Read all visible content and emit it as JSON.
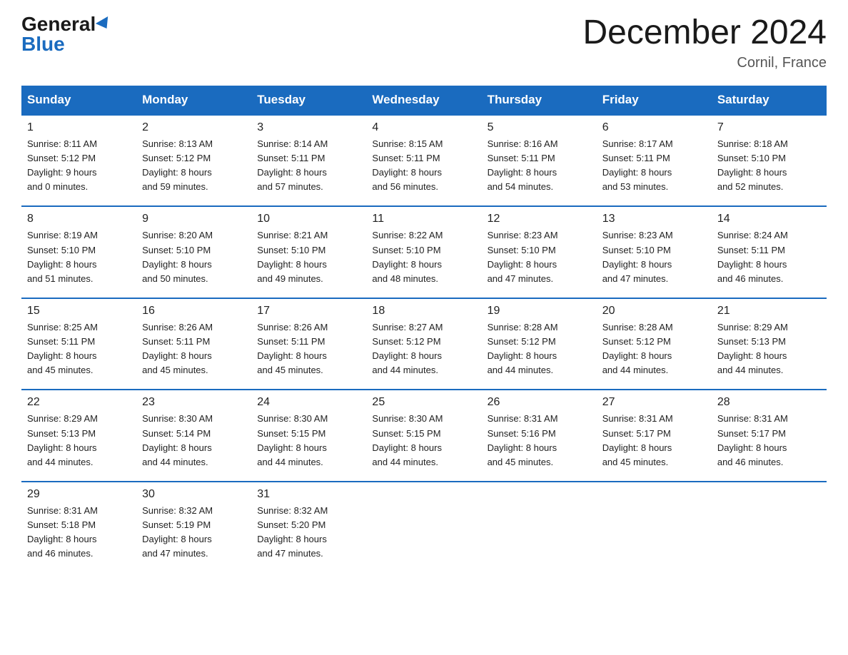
{
  "header": {
    "logo_general": "General",
    "logo_blue": "Blue",
    "month_title": "December 2024",
    "location": "Cornil, France"
  },
  "weekdays": [
    "Sunday",
    "Monday",
    "Tuesday",
    "Wednesday",
    "Thursday",
    "Friday",
    "Saturday"
  ],
  "weeks": [
    [
      {
        "day": "1",
        "detail": "Sunrise: 8:11 AM\nSunset: 5:12 PM\nDaylight: 9 hours\nand 0 minutes."
      },
      {
        "day": "2",
        "detail": "Sunrise: 8:13 AM\nSunset: 5:12 PM\nDaylight: 8 hours\nand 59 minutes."
      },
      {
        "day": "3",
        "detail": "Sunrise: 8:14 AM\nSunset: 5:11 PM\nDaylight: 8 hours\nand 57 minutes."
      },
      {
        "day": "4",
        "detail": "Sunrise: 8:15 AM\nSunset: 5:11 PM\nDaylight: 8 hours\nand 56 minutes."
      },
      {
        "day": "5",
        "detail": "Sunrise: 8:16 AM\nSunset: 5:11 PM\nDaylight: 8 hours\nand 54 minutes."
      },
      {
        "day": "6",
        "detail": "Sunrise: 8:17 AM\nSunset: 5:11 PM\nDaylight: 8 hours\nand 53 minutes."
      },
      {
        "day": "7",
        "detail": "Sunrise: 8:18 AM\nSunset: 5:10 PM\nDaylight: 8 hours\nand 52 minutes."
      }
    ],
    [
      {
        "day": "8",
        "detail": "Sunrise: 8:19 AM\nSunset: 5:10 PM\nDaylight: 8 hours\nand 51 minutes."
      },
      {
        "day": "9",
        "detail": "Sunrise: 8:20 AM\nSunset: 5:10 PM\nDaylight: 8 hours\nand 50 minutes."
      },
      {
        "day": "10",
        "detail": "Sunrise: 8:21 AM\nSunset: 5:10 PM\nDaylight: 8 hours\nand 49 minutes."
      },
      {
        "day": "11",
        "detail": "Sunrise: 8:22 AM\nSunset: 5:10 PM\nDaylight: 8 hours\nand 48 minutes."
      },
      {
        "day": "12",
        "detail": "Sunrise: 8:23 AM\nSunset: 5:10 PM\nDaylight: 8 hours\nand 47 minutes."
      },
      {
        "day": "13",
        "detail": "Sunrise: 8:23 AM\nSunset: 5:10 PM\nDaylight: 8 hours\nand 47 minutes."
      },
      {
        "day": "14",
        "detail": "Sunrise: 8:24 AM\nSunset: 5:11 PM\nDaylight: 8 hours\nand 46 minutes."
      }
    ],
    [
      {
        "day": "15",
        "detail": "Sunrise: 8:25 AM\nSunset: 5:11 PM\nDaylight: 8 hours\nand 45 minutes."
      },
      {
        "day": "16",
        "detail": "Sunrise: 8:26 AM\nSunset: 5:11 PM\nDaylight: 8 hours\nand 45 minutes."
      },
      {
        "day": "17",
        "detail": "Sunrise: 8:26 AM\nSunset: 5:11 PM\nDaylight: 8 hours\nand 45 minutes."
      },
      {
        "day": "18",
        "detail": "Sunrise: 8:27 AM\nSunset: 5:12 PM\nDaylight: 8 hours\nand 44 minutes."
      },
      {
        "day": "19",
        "detail": "Sunrise: 8:28 AM\nSunset: 5:12 PM\nDaylight: 8 hours\nand 44 minutes."
      },
      {
        "day": "20",
        "detail": "Sunrise: 8:28 AM\nSunset: 5:12 PM\nDaylight: 8 hours\nand 44 minutes."
      },
      {
        "day": "21",
        "detail": "Sunrise: 8:29 AM\nSunset: 5:13 PM\nDaylight: 8 hours\nand 44 minutes."
      }
    ],
    [
      {
        "day": "22",
        "detail": "Sunrise: 8:29 AM\nSunset: 5:13 PM\nDaylight: 8 hours\nand 44 minutes."
      },
      {
        "day": "23",
        "detail": "Sunrise: 8:30 AM\nSunset: 5:14 PM\nDaylight: 8 hours\nand 44 minutes."
      },
      {
        "day": "24",
        "detail": "Sunrise: 8:30 AM\nSunset: 5:15 PM\nDaylight: 8 hours\nand 44 minutes."
      },
      {
        "day": "25",
        "detail": "Sunrise: 8:30 AM\nSunset: 5:15 PM\nDaylight: 8 hours\nand 44 minutes."
      },
      {
        "day": "26",
        "detail": "Sunrise: 8:31 AM\nSunset: 5:16 PM\nDaylight: 8 hours\nand 45 minutes."
      },
      {
        "day": "27",
        "detail": "Sunrise: 8:31 AM\nSunset: 5:17 PM\nDaylight: 8 hours\nand 45 minutes."
      },
      {
        "day": "28",
        "detail": "Sunrise: 8:31 AM\nSunset: 5:17 PM\nDaylight: 8 hours\nand 46 minutes."
      }
    ],
    [
      {
        "day": "29",
        "detail": "Sunrise: 8:31 AM\nSunset: 5:18 PM\nDaylight: 8 hours\nand 46 minutes."
      },
      {
        "day": "30",
        "detail": "Sunrise: 8:32 AM\nSunset: 5:19 PM\nDaylight: 8 hours\nand 47 minutes."
      },
      {
        "day": "31",
        "detail": "Sunrise: 8:32 AM\nSunset: 5:20 PM\nDaylight: 8 hours\nand 47 minutes."
      },
      {
        "day": "",
        "detail": ""
      },
      {
        "day": "",
        "detail": ""
      },
      {
        "day": "",
        "detail": ""
      },
      {
        "day": "",
        "detail": ""
      }
    ]
  ]
}
